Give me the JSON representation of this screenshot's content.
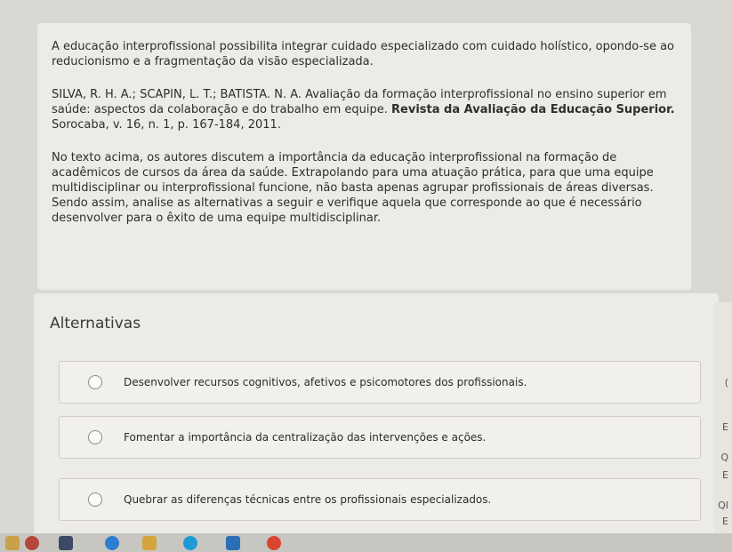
{
  "question": {
    "statement": "A educação interprofissional possibilita integrar cuidado especializado com cuidado holístico, opondo-se ao reducionismo e a fragmentação da visão especializada.",
    "reference_authors": "SILVA, R. H. A.; SCAPIN, L. T.; BATISTA. N. A. Avaliação da formação interprofissional no ensino superior em saúde: aspectos da colaboração e do trabalho em equipe. ",
    "reference_journal": "Revista da Avaliação da Educação Superior.",
    "reference_details": "Sorocaba, v. 16, n. 1, p. 167-184, 2011.",
    "prompt": "No texto acima, os autores discutem a importância da educação interprofissional na formação de acadêmicos de cursos da área da saúde. Extrapolando para uma atuação prática, para que uma equipe multidisciplinar ou interprofissional funcione, não basta apenas agrupar profissionais de áreas diversas. Sendo assim, analise as alternativas a seguir e verifique aquela que corresponde ao que é necessário desenvolver para o êxito de uma equipe multidisciplinar."
  },
  "alternatives": {
    "title": "Alternativas",
    "options": [
      "Desenvolver recursos cognitivos, afetivos e psicomotores dos profissionais.",
      "Fomentar a importância da centralização das intervenções e ações.",
      "Quebrar as diferenças técnicas entre os profissionais especializados."
    ]
  },
  "side_panel": {
    "glyphs": [
      "(",
      "E",
      "Q",
      "E",
      "QI",
      "E"
    ]
  },
  "colors": {
    "background": "#d9d8d3",
    "card": "#ecebe7",
    "option_bg": "#f1f0ec",
    "text": "#2e2e2e"
  }
}
